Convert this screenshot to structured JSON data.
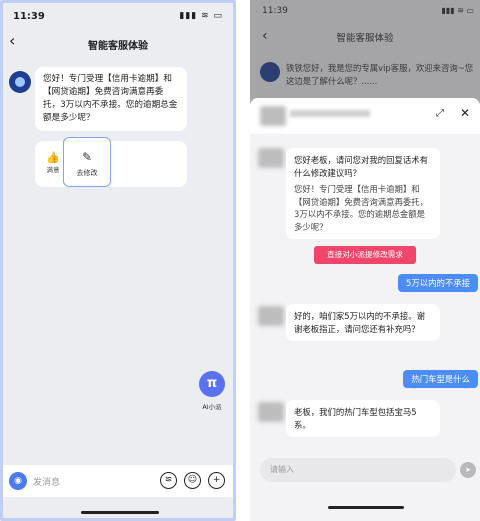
{
  "left": {
    "status_time": "11:39",
    "status_icons": "▮▮▮ ≋ ▭",
    "back_glyph": "‹",
    "title": "智能客服体验",
    "bot_message": "您好！专门受理【信用卡逾期】和【网贷逾期】免费咨询满意再委托，3万以内不承接。您的逾期总金额是多少呢？",
    "action_like": "满意",
    "action_edit": "去修改",
    "ai_icon": "π",
    "ai_label": "AI小派",
    "input_placeholder": "发消息",
    "icons": [
      "camera-icon",
      "voice-icon",
      "emoji-icon",
      "plus-icon"
    ]
  },
  "right": {
    "status_time": "11:39",
    "status_icons": "▮▮▮ ≋ ▭",
    "back_glyph": "‹",
    "title": "智能客服体验",
    "bg_message": "铁铁您好，我是您的专属vip客服，欢迎来咨询~您这边是了解什么呢？......",
    "expand_icon": "⤢",
    "close_icon": "✕",
    "msg1_line1": "您好老板，请问您对我的回复话术有什么修改建议吗？",
    "msg1_quote": "您好！专门受理【信用卡逾期】和【网贷逾期】免费咨询满意再委托，3万以内不承接。您的逾期总金额是多少呢？",
    "red_tag": "直接对小派提修改需求",
    "user1": "5万以内的不承接",
    "msg2": "好的，咱们家5万以内的不承接。谢谢老板指正，请问您还有补充吗？",
    "user2": "热门车型是什么",
    "msg3": "老板，我们的热门车型包括宝马5系。",
    "input_placeholder": "请输入",
    "send_icon": "➤"
  },
  "colors": {
    "accent_blue": "#4d8cf5",
    "tag_red": "#f0466b",
    "frame_border": "#c2cdf2"
  }
}
